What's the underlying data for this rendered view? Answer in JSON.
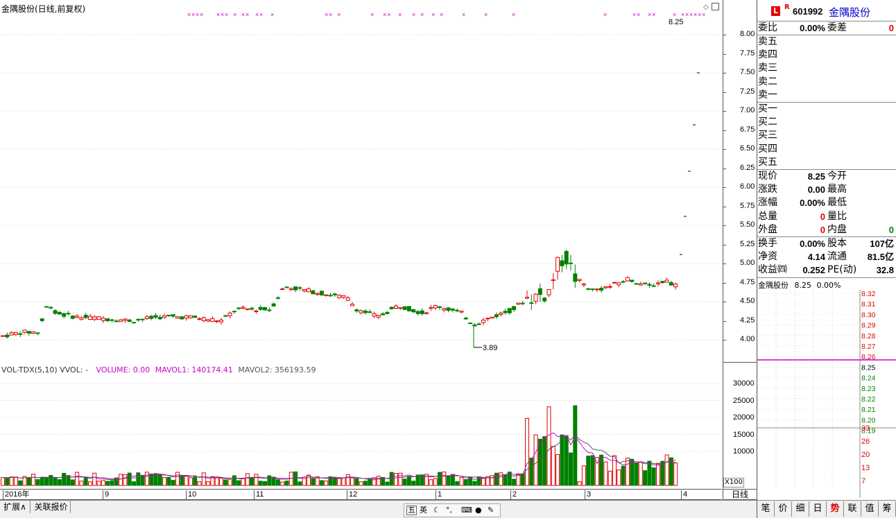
{
  "chart_title": "金隅股份(日线,前复权)",
  "price_last_label": "8.25",
  "price_low_label": "3.89",
  "price_axis": [
    "8.00",
    "7.75",
    "7.50",
    "7.25",
    "7.00",
    "6.75",
    "6.50",
    "6.25",
    "6.00",
    "5.75",
    "5.50",
    "5.25",
    "5.00",
    "4.75",
    "4.50",
    "4.25",
    "4.00"
  ],
  "vol_header": {
    "name": "VOL-TDX(5,10) VVOL: -",
    "volume": "VOLUME: 0.00",
    "mavol1": "MAVOL1: 140174.41",
    "mavol2": "MAVOL2: 356193.59"
  },
  "vol_axis": [
    "30000",
    "25000",
    "20000",
    "15000",
    "10000"
  ],
  "vol_unit": "X100",
  "time_axis": [
    "2016年",
    "9",
    "10",
    "11",
    "12",
    "1",
    "2",
    "3",
    "4"
  ],
  "period_label": "日线",
  "bottom_tabs": [
    "扩展∧",
    "关联报价"
  ],
  "ime_bar": [
    "五",
    "英"
  ],
  "quote": {
    "code": "601992",
    "name": "金隅股份",
    "badge_L": "L",
    "badge_R": "R",
    "weibi_label": "委比",
    "weibi_value": "0.00%",
    "weicha_label": "委差",
    "weicha_value": "0",
    "sell": [
      "卖五",
      "卖四",
      "卖三",
      "卖二",
      "卖一"
    ],
    "buy": [
      "买一",
      "买二",
      "买三",
      "买四",
      "买五"
    ],
    "stats_left": [
      {
        "label": "现价",
        "value": "8.25",
        "color": "#000"
      },
      {
        "label": "涨跌",
        "value": "0.00",
        "color": "#000"
      },
      {
        "label": "涨幅",
        "value": "0.00%",
        "color": "#000"
      },
      {
        "label": "总量",
        "value": "0",
        "color": "#e00000"
      },
      {
        "label": "外盘",
        "value": "0",
        "color": "#e00000"
      }
    ],
    "stats_right": [
      {
        "label": "今开",
        "value": "",
        "color": "#000"
      },
      {
        "label": "最高",
        "value": "",
        "color": "#000"
      },
      {
        "label": "最低",
        "value": "",
        "color": "#000"
      },
      {
        "label": "量比",
        "value": "",
        "color": "#000"
      },
      {
        "label": "内盘",
        "value": "0",
        "color": "#008000"
      }
    ],
    "fund_left": [
      {
        "label": "换手",
        "value": "0.00%"
      },
      {
        "label": "净资",
        "value": "4.14"
      },
      {
        "label": "收益㈣",
        "value": "0.252"
      }
    ],
    "fund_right": [
      {
        "label": "股本",
        "value": "107亿"
      },
      {
        "label": "流通",
        "value": "81.5亿"
      },
      {
        "label": "PE(动)",
        "value": "32.8"
      }
    ],
    "mini_title": "金隅股份",
    "mini_price": "8.25",
    "mini_pct": "0.00%",
    "mini_axis": [
      {
        "v": "8.32",
        "c": "#e00000"
      },
      {
        "v": "8.31",
        "c": "#e00000"
      },
      {
        "v": "8.30",
        "c": "#e00000"
      },
      {
        "v": "8.29",
        "c": "#e00000"
      },
      {
        "v": "8.28",
        "c": "#e00000"
      },
      {
        "v": "8.27",
        "c": "#e00000"
      },
      {
        "v": "8.26",
        "c": "#e00000"
      },
      {
        "v": "8.25",
        "c": "#000"
      },
      {
        "v": "8.24",
        "c": "#008000"
      },
      {
        "v": "8.23",
        "c": "#008000"
      },
      {
        "v": "8.22",
        "c": "#008000"
      },
      {
        "v": "8.21",
        "c": "#008000"
      },
      {
        "v": "8.20",
        "c": "#008000"
      },
      {
        "v": "8.19",
        "c": "#008000"
      }
    ],
    "mini_vol_axis": [
      "33",
      "26",
      "20",
      "13",
      "7"
    ],
    "side_tabs": [
      "笔",
      "价",
      "细",
      "日",
      "势",
      "联",
      "值",
      "筹"
    ]
  },
  "colors": {
    "up": "#e00000",
    "down": "#008000",
    "ma1": "#cc00cc",
    "ma2": "#555555"
  }
}
